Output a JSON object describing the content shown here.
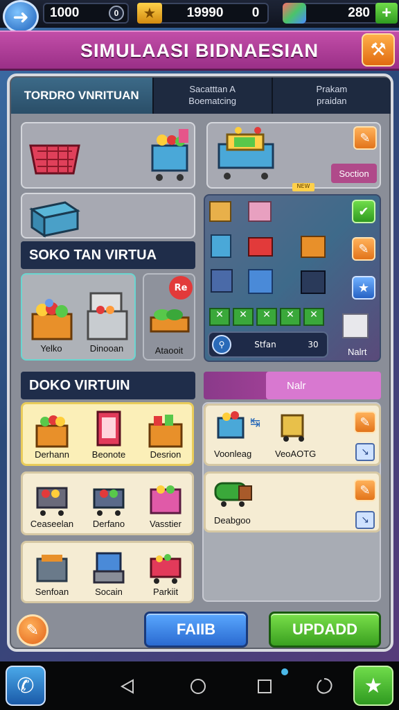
{
  "topbar": {
    "res1_value": "1000",
    "res1_badge": "0",
    "res2_value": "19990",
    "res2_badge": "0",
    "res3_value": "280",
    "add_label": "+"
  },
  "title": "SIMULAASI BIDNAESIAN",
  "tabs": [
    {
      "label": "TORDRO VNRITUAN"
    },
    {
      "label": "Sacatttan A\nBoematcing"
    },
    {
      "label": "Prakam\npraidan"
    }
  ],
  "top_right": {
    "action_label": "Soction",
    "tag": "NEW"
  },
  "sections": {
    "s1": "SOKO TAN VIRTUA",
    "s2": "DOKO VIRTUIN",
    "s3_tab": "Nalr"
  },
  "soko_items": [
    {
      "label": "Yelko"
    },
    {
      "label": "Dinooan"
    },
    {
      "label": "Ataooit",
      "badge": "Re"
    }
  ],
  "right_grid": {
    "check_labels": [
      "✕",
      "✕",
      "✕",
      "✕",
      "✕"
    ],
    "search_label": "Stfan",
    "search_count": "30",
    "side_item": "Nalrt"
  },
  "doko_rows": [
    [
      {
        "label": "Derhann"
      },
      {
        "label": "Beonote"
      },
      {
        "label": "Desrion"
      }
    ],
    [
      {
        "label": "Ceaseelan"
      },
      {
        "label": "Derfano"
      },
      {
        "label": "Vasstier"
      }
    ],
    [
      {
        "label": "Senfoan"
      },
      {
        "label": "Socain"
      },
      {
        "label": "Parkiit"
      }
    ]
  ],
  "right_cards": [
    {
      "labels": [
        "Voonleag",
        "VeoAOTG"
      ]
    },
    {
      "labels": [
        "Deabgoo"
      ]
    }
  ],
  "buttons": {
    "left": "FAIIB",
    "right": "UPDADD"
  },
  "colors": {
    "accent": "#b0409a",
    "green": "#3fae2a",
    "blue": "#2c7ad6"
  }
}
